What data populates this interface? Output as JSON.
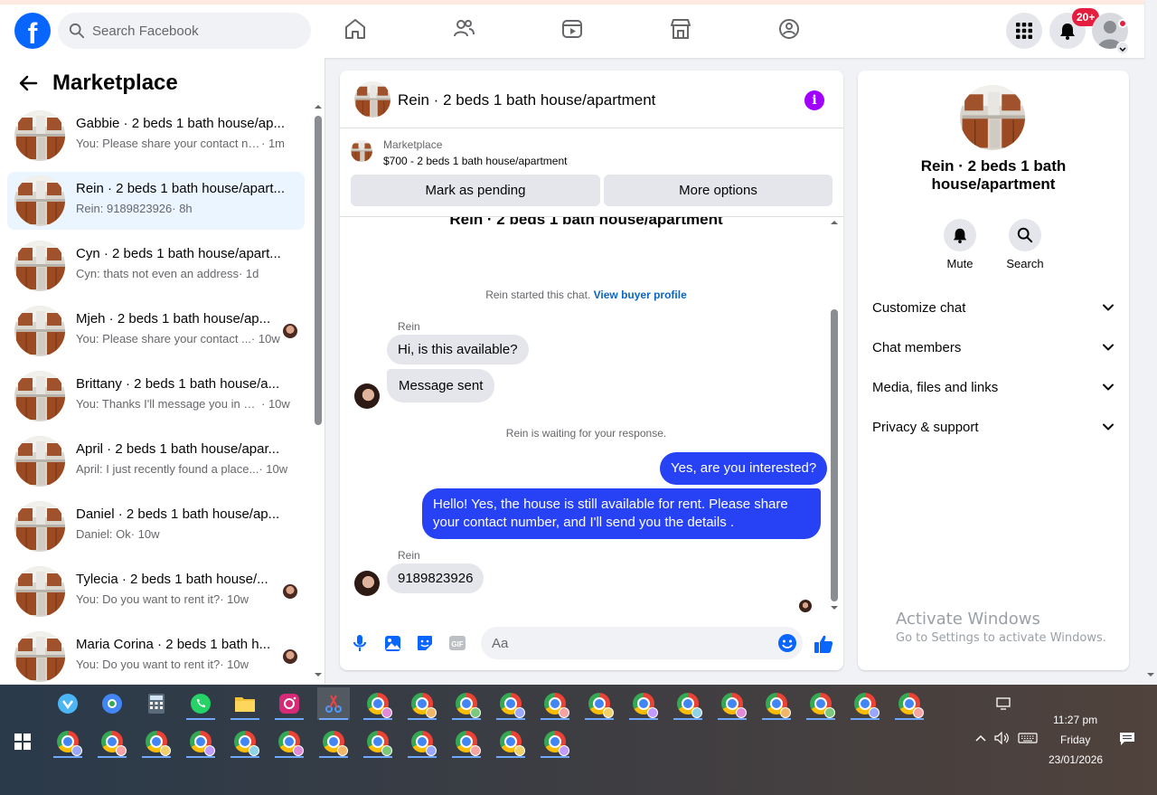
{
  "topnav": {
    "logo": "f",
    "search_placeholder": "Search Facebook",
    "notification_badge": "20+"
  },
  "marketplace": {
    "title": "Marketplace",
    "conversations": [
      {
        "title": "Gabbie · 2 beds 1 bath house/ap...",
        "preview": "You: Please share your contact nu...",
        "time": " · 1m",
        "active": false,
        "avatar": false
      },
      {
        "title": "Rein · 2 beds 1 bath house/apart...",
        "preview": "Rein: 9189823926",
        "time": " · 8h",
        "active": true,
        "avatar": false
      },
      {
        "title": "Cyn · 2 beds 1 bath house/apart...",
        "preview": "Cyn: thats not even an address",
        "time": " · 1d",
        "active": false,
        "avatar": false
      },
      {
        "title": "Mjeh · 2 beds 1 bath house/ap...",
        "preview": "You: Please share your contact ...",
        "time": " · 10w",
        "active": false,
        "avatar": true
      },
      {
        "title": "Brittany · 2 beds 1 bath house/a...",
        "preview": "You: Thanks I'll message you in a ...",
        "time": " · 10w",
        "active": false,
        "avatar": false
      },
      {
        "title": "April · 2 beds 1 bath house/apar...",
        "preview": "April: I just recently found a place...",
        "time": " · 10w",
        "active": false,
        "avatar": false
      },
      {
        "title": "Daniel · 2 beds 1 bath house/ap...",
        "preview": "Daniel: Ok",
        "time": " · 10w",
        "active": false,
        "avatar": false
      },
      {
        "title": "Tylecia · 2 beds 1 bath house/...",
        "preview": "You: Do you want to rent it?",
        "time": " · 10w",
        "active": false,
        "avatar": true
      },
      {
        "title": "Maria Corina · 2 beds 1 bath h...",
        "preview": "You: Do you want to rent it?",
        "time": " · 10w",
        "active": false,
        "avatar": true
      }
    ]
  },
  "chat": {
    "title": "Rein · 2 beds 1 bath house/apartment",
    "marketplace_label": "Marketplace",
    "listing": "$700 - 2 beds 1 bath house/apartment",
    "mark_pending": "Mark as pending",
    "more_options": "More options",
    "cut_title": "Rein · 2 beds 1 bath house/apartment",
    "started_text": "Rein started this chat.",
    "view_buyer": "View buyer profile",
    "sender": "Rein",
    "msg1": "Hi, is this available?",
    "msg2": "Message sent",
    "waiting": "Rein is waiting for your response.",
    "out1": "Yes, are you interested?",
    "out2": "Hello! Yes, the house is still available for rent. Please share your contact number, and I'll send you the details .",
    "sender2": "Rein",
    "msg3": "9189823926",
    "input_placeholder": "Aa",
    "gif_label": "GIF"
  },
  "details": {
    "title": "Rein · 2 beds 1 bath house/apartment",
    "mute": "Mute",
    "search": "Search",
    "rows": [
      "Customize chat",
      "Chat members",
      "Media, files and links",
      "Privacy & support"
    ]
  },
  "watermark": {
    "line1": "Activate Windows",
    "line2": "Go to Settings to activate Windows."
  },
  "taskbar": {
    "time": "11:27 pm",
    "day": "Friday",
    "date": "23/01/2026"
  },
  "colors": {
    "brand": "#0866ff",
    "outgoing_bubble": "#2741f5",
    "incoming_bubble": "#e4e6eb",
    "active_row": "#ebf5ff",
    "badge": "#e41e3f"
  }
}
